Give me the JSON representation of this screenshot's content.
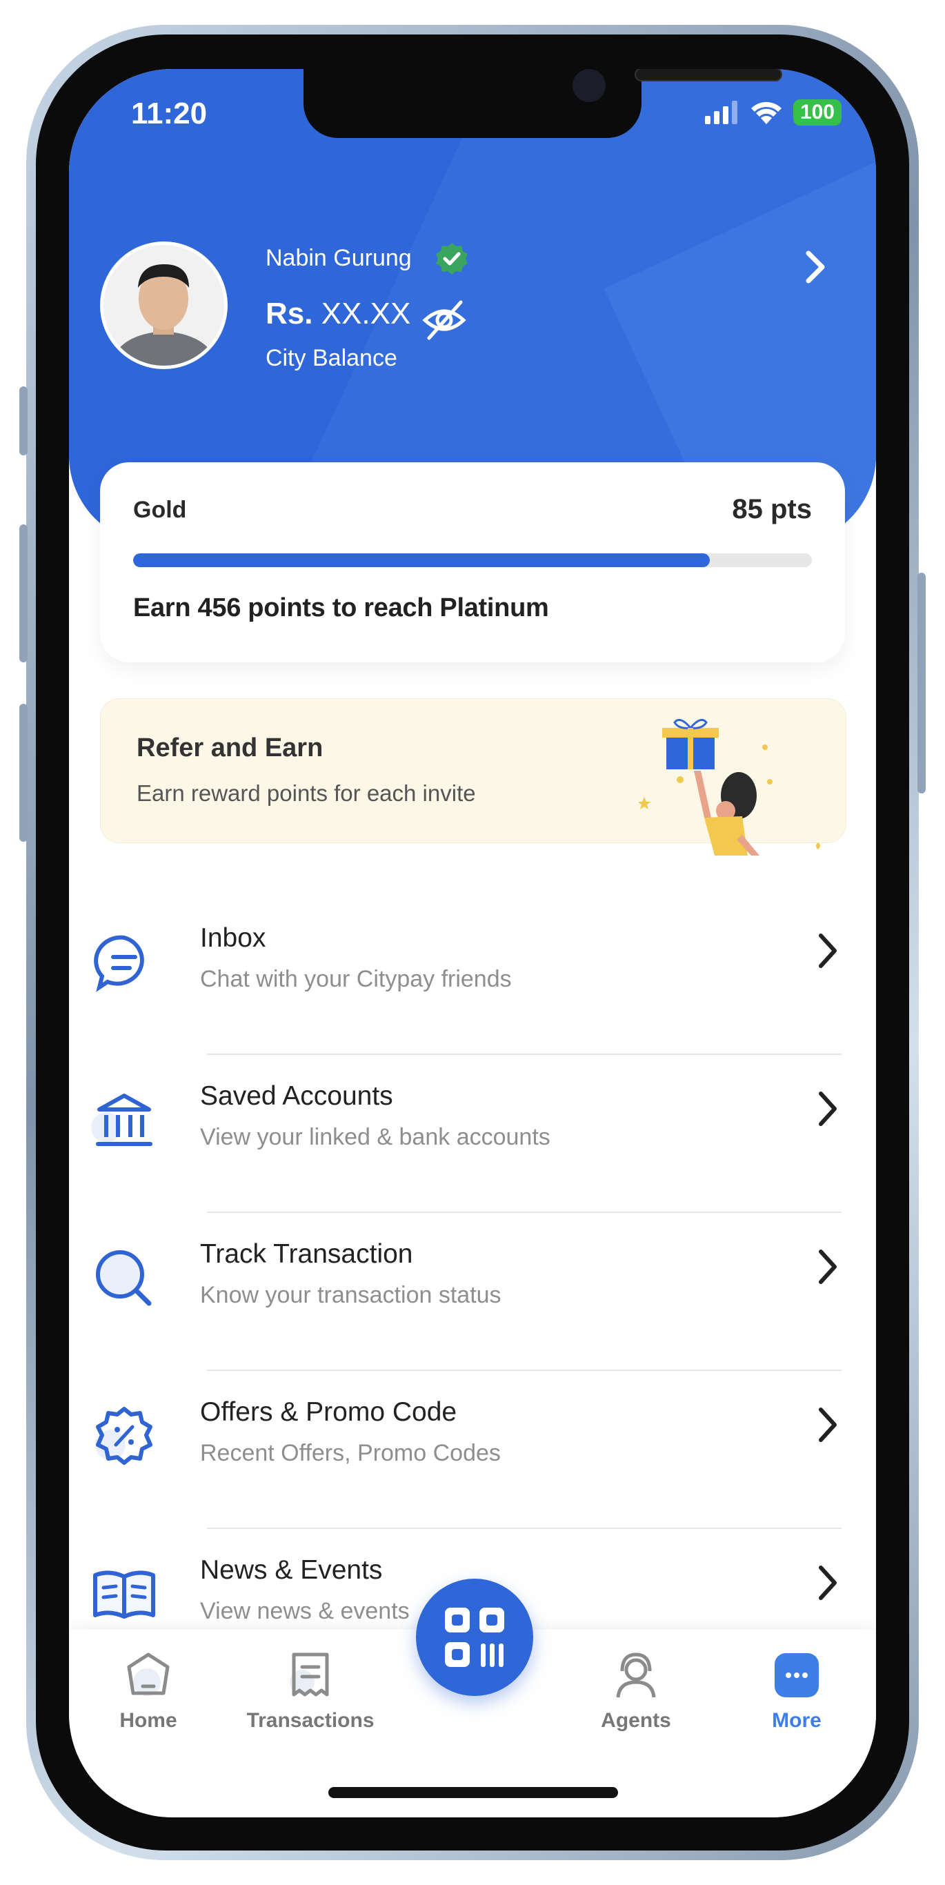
{
  "status": {
    "time": "11:20",
    "battery": "100"
  },
  "profile": {
    "name": "Nabin Gurung",
    "balance_currency": "Rs.",
    "balance_value": "XX.XX",
    "balance_label": "City Balance"
  },
  "rewards": {
    "tier": "Gold",
    "points": "85 pts",
    "progress_fraction": 0.85,
    "message": "Earn 456 points to reach Platinum"
  },
  "refer": {
    "title": "Refer and Earn",
    "subtitle": "Earn reward points for each invite"
  },
  "menu": {
    "items": [
      {
        "title": "Inbox",
        "subtitle": "Chat with your Citypay friends",
        "icon": "chat-icon"
      },
      {
        "title": "Saved Accounts",
        "subtitle": "View your linked & bank accounts",
        "icon": "bank-icon"
      },
      {
        "title": "Track Transaction",
        "subtitle": "Know your transaction status",
        "icon": "search-icon"
      },
      {
        "title": "Offers & Promo Code",
        "subtitle": "Recent Offers, Promo Codes",
        "icon": "discount-badge-icon"
      },
      {
        "title": "News & Events",
        "subtitle": "View news & events",
        "icon": "newspaper-icon"
      }
    ]
  },
  "tabbar": {
    "home": "Home",
    "transactions": "Transactions",
    "agents": "Agents",
    "more": "More"
  },
  "colors": {
    "primary": "#2f66d8",
    "active_tab": "#3f7ee6",
    "refer_bg": "#fdf7e8",
    "battery": "#36c04a",
    "verified": "#3aa55c"
  }
}
